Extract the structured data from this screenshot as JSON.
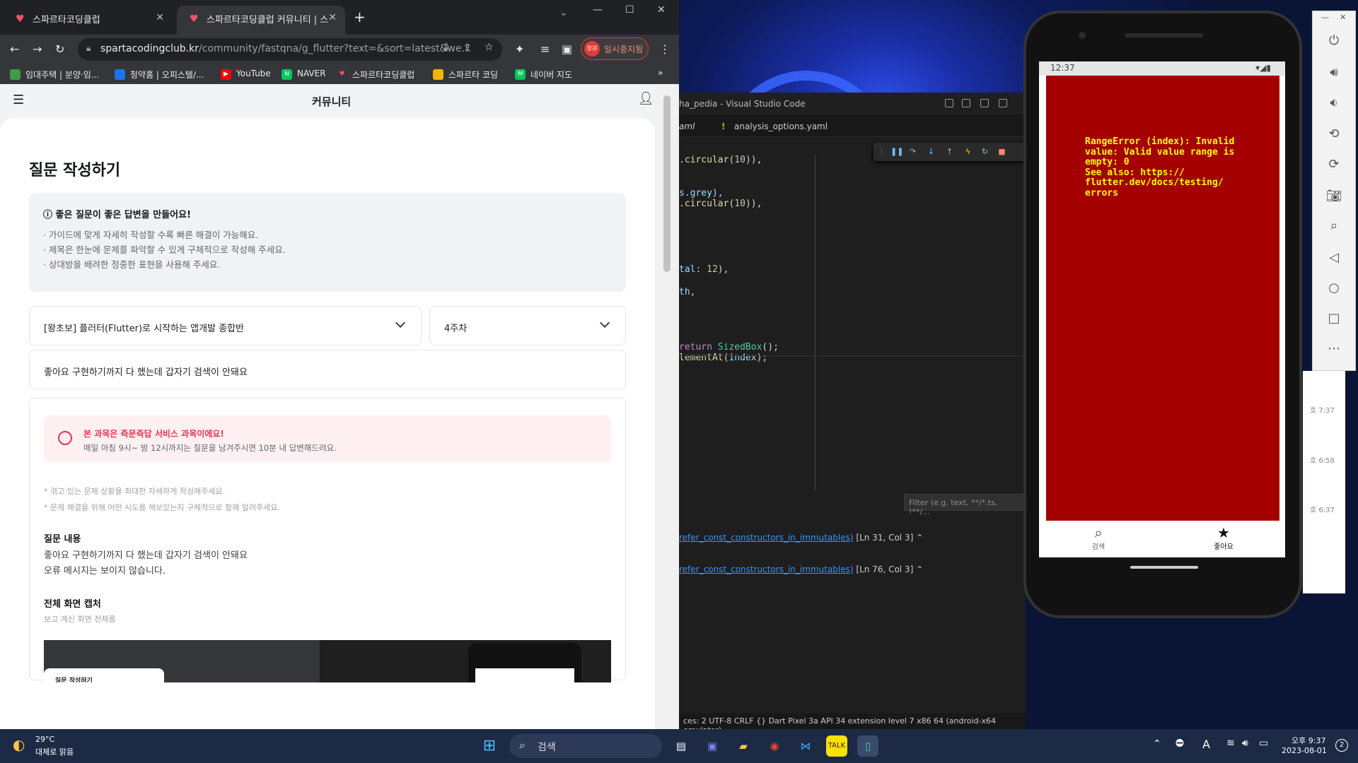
{
  "browser": {
    "tabs": [
      {
        "label": "스파르타코딩클럽"
      },
      {
        "label": "스파르타코딩클럽 커뮤니티 | 스"
      }
    ],
    "url_domain": "spartacodingclub.kr",
    "url_path": "/community/fastqna/g_flutter?text=&sort=latest&we...",
    "paused_label": "일시중지됨",
    "profile_label": "창원",
    "bookmarks": [
      {
        "label": "임대주택 | 분양·임...",
        "color": "#3d9b48",
        "mark": "L"
      },
      {
        "label": "청약홈 | 오피스텔/...",
        "color": "#1e73e8",
        "mark": "C"
      },
      {
        "label": "YouTube",
        "color": "#ff0000",
        "mark": "▶"
      },
      {
        "label": "NAVER",
        "color": "#03c75a",
        "mark": "N"
      },
      {
        "label": "스파르타코딩클럽",
        "color": "#f2536b",
        "mark": "♥"
      },
      {
        "label": "스파르타 코딩",
        "color": "#f4b400",
        "mark": ""
      },
      {
        "label": "네이버 지도",
        "color": "#03c75a",
        "mark": "M"
      }
    ]
  },
  "community": {
    "header_title": "커뮤니티",
    "page_title": "질문 작성하기",
    "guide": {
      "title": "좋은 질문이 좋은 답변을 만들어요!",
      "lines": [
        "· 가이드에 맞게 자세히 작성할 수록 빠른 해결이 가능해요.",
        "· 제목은 한눈에 문제를 파악할 수 있게 구체적으로 작성해 주세요.",
        "· 상대방을 배려한 정중한 표현을 사용해 주세요."
      ]
    },
    "course_select": "[왕초보] 플러터(Flutter)로 시작하는 앱개발 종합반",
    "week_select": "4주차",
    "title_input": "좋아요 구현하기까지 다 했는데 갑자기 검색이 안돼요",
    "notice": {
      "title": "본 과목은 즉문즉답 서비스 과목이에요!",
      "desc": "매일 아침 9시~ 밤 12시까지는 질문을 남겨주시면 10분 내 답변해드려요."
    },
    "hints": [
      "* 겪고 있는 문제 상황을 최대한 자세하게 작성해주세요.",
      "* 문제 해결을 위해 어떤 시도를 해보았는지 구체적으로 함께 알려주세요."
    ],
    "content_label": "질문 내용",
    "content_lines": [
      "좋아요 구현하기까지 다 했는데 갑자기 검색이 안돼요",
      "오류 메시지는 보이지 않습니다."
    ],
    "capture_label": "전체 화면 캡처",
    "capture_hint": "보고 계신 화면 전체를",
    "capture_inner_title": "질문 작성하기"
  },
  "vscode": {
    "title": "ha_pedia - Visual Studio Code",
    "tabs": [
      "aml",
      "analysis_options.yaml"
    ],
    "tab_warn": "!",
    "code": [
      {
        "a": ".",
        "b": "circular",
        "c": "(",
        "d": "10",
        "e": ")),"
      },
      {
        "a": "",
        "b": "s.grey),",
        "c": "",
        "d": "",
        "e": ""
      },
      {
        "a": ".",
        "b": "circular",
        "c": "(",
        "d": "10",
        "e": ")),"
      },
      {
        "a": "tal: ",
        "b": "",
        "c": "",
        "d": "12",
        "e": "),"
      },
      {
        "a": "th,",
        "b": "",
        "c": "",
        "d": "",
        "e": ""
      },
      {
        "a": "return ",
        "b": "SizedBox",
        "c": "();",
        "d": "",
        "e": ""
      },
      {
        "a": "lementAt(",
        "b": "index",
        "c": ");",
        "d": "",
        "e": ""
      }
    ],
    "filter_placeholder": "Filter (e.g. text, **/*.ts, !**/...",
    "problems": [
      {
        "link": "refer_const_constructors_in_immutables)",
        "pos": "[Ln 31, Col 3]"
      },
      {
        "link": "refer_const_constructors_in_immutables)",
        "pos": "[Ln 76, Col 3]"
      }
    ],
    "statusbar": "ces: 2    UTF-8    CRLF    {} Dart    Pixel 3a API 34 extension level 7 x86 64 (android-x64 emulator)"
  },
  "phone": {
    "time": "12:37",
    "error": "RangeError (index): Invalid\nvalue: Valid value range is\nempty: 0\nSee also: https://\nflutter.dev/docs/testing/\nerrors",
    "nav": [
      {
        "label": "검색",
        "icon": "search-icon"
      },
      {
        "label": "좋아요",
        "icon": "star-icon"
      }
    ]
  },
  "emulator": {
    "icons": [
      "power-icon",
      "volume-up-icon",
      "volume-down-icon",
      "rotate-left-icon",
      "rotate-right-icon",
      "camera-icon",
      "zoom-icon",
      "back-icon",
      "home-icon",
      "overview-icon",
      "more-icon"
    ]
  },
  "behind_times": [
    "호 7:37",
    "호 6:58",
    "호 6:37"
  ],
  "taskbar": {
    "temp": "29°C",
    "weather": "대체로 맑음",
    "search": "검색",
    "time": "오후 9:37",
    "date": "2023-08-01",
    "badge": "2"
  }
}
